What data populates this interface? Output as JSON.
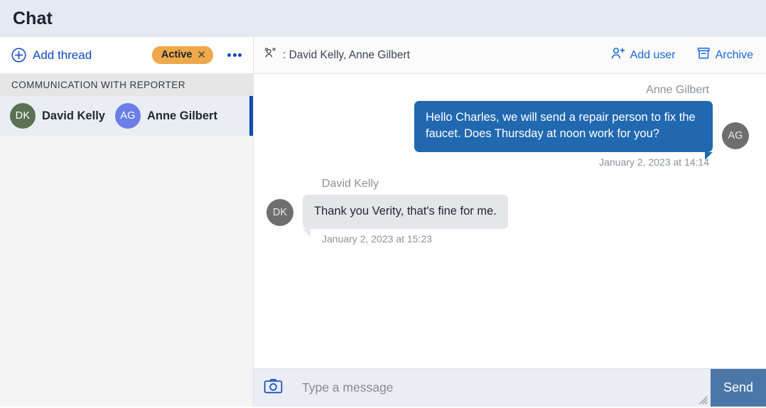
{
  "window": {
    "title": "Chat"
  },
  "sidebar": {
    "add_thread": {
      "label": "Add thread",
      "icon": "plus-circle-icon"
    },
    "status_badge": {
      "label": "Active",
      "close_glyph": "✕",
      "color": "#efa94a"
    },
    "overflow_menu": {
      "icon": "more-options-icon"
    },
    "section_title": "COMMUNICATION WITH REPORTER",
    "threads": [
      {
        "selected": true,
        "accent_color": "#0a4bad",
        "participants": [
          {
            "initials": "DK",
            "name": "David Kelly",
            "avatar_color": "#5b7152"
          },
          {
            "initials": "AG",
            "name": "Anne Gilbert",
            "avatar_color": "#6b7fe8"
          }
        ]
      }
    ]
  },
  "chat": {
    "header": {
      "participants_icon": "people-icon",
      "participants": ": David Kelly, Anne Gilbert",
      "actions": [
        {
          "label": "Add user",
          "icon": "user-plus-icon"
        },
        {
          "label": "Archive",
          "icon": "archive-icon"
        }
      ],
      "link_color": "#1565d8"
    },
    "messages": [
      {
        "direction": "out",
        "author": "Anne Gilbert",
        "text": "Hello Charles, we will send a repair person to fix the faucet. Does Thursday at noon work for you?",
        "time": "January 2, 2023 at 14:14",
        "avatar_initials": "AG",
        "bubble_color": "#2168b0"
      },
      {
        "direction": "in",
        "author": "David Kelly",
        "text": "Thank you Verity, that's fine for me.",
        "time": "January 2, 2023 at 15:23",
        "avatar_initials": "DK",
        "bubble_color": "#e5e6e9"
      }
    ],
    "composer": {
      "camera_icon": "camera-icon",
      "placeholder": "Type a message",
      "value": "",
      "send_label": "Send",
      "send_color": "#4a77a8",
      "resize_grip": "resize-grip-icon"
    }
  }
}
